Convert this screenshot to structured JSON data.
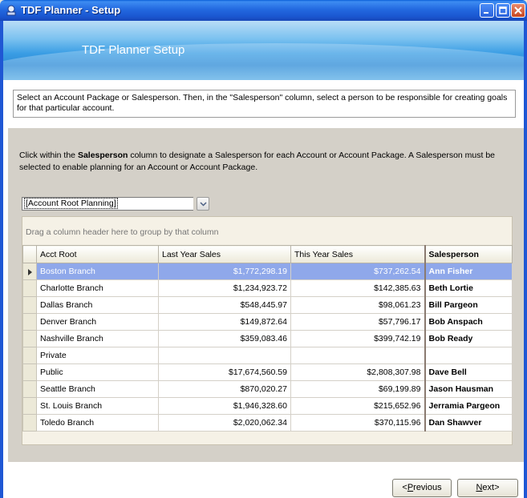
{
  "window": {
    "title": "TDF Planner - Setup",
    "icon": "tdf-planner-icon"
  },
  "banner": {
    "title": "TDF Planner Setup"
  },
  "instructions": "Select an Account Package or Salesperson. Then, in the \"Salesperson\" column, select a person to be responsible for creating goals for that particular account.",
  "panel": {
    "desc_prefix": "Click within the ",
    "desc_bold": "Salesperson",
    "desc_suffix": " column to designate a Salesperson for each Account or Account Package.  A Salesperson must be selected to enable planning for an Account or Account Package.",
    "combo_value": "[Account Root Planning]",
    "group_hint": "Drag a column header here to group by that column"
  },
  "grid": {
    "columns": [
      "Acct Root",
      "Last Year Sales",
      "This Year Sales",
      "Salesperson"
    ],
    "selected_row": 0,
    "rows": [
      {
        "acct": "Boston Branch",
        "last": "$1,772,298.19",
        "this": "$737,262.54",
        "sales": "Ann Fisher"
      },
      {
        "acct": "Charlotte Branch",
        "last": "$1,234,923.72",
        "this": "$142,385.63",
        "sales": "Beth Lortie"
      },
      {
        "acct": "Dallas Branch",
        "last": "$548,445.97",
        "this": "$98,061.23",
        "sales": "Bill Pargeon"
      },
      {
        "acct": "Denver Branch",
        "last": "$149,872.64",
        "this": "$57,796.17",
        "sales": "Bob Anspach"
      },
      {
        "acct": "Nashville Branch",
        "last": "$359,083.46",
        "this": "$399,742.19",
        "sales": "Bob Ready"
      },
      {
        "acct": "Private",
        "last": "",
        "this": "",
        "sales": ""
      },
      {
        "acct": "Public",
        "last": "$17,674,560.59",
        "this": "$2,808,307.98",
        "sales": "Dave Bell"
      },
      {
        "acct": "Seattle Branch",
        "last": "$870,020.27",
        "this": "$69,199.89",
        "sales": "Jason Hausman"
      },
      {
        "acct": "St. Louis Branch",
        "last": "$1,946,328.60",
        "this": "$215,652.96",
        "sales": "Jerramia Pargeon"
      },
      {
        "acct": "Toledo Branch",
        "last": "$2,020,062.34",
        "this": "$370,115.96",
        "sales": "Dan Shawver"
      }
    ]
  },
  "buttons": {
    "previous": {
      "mnemonic": "P",
      "rest": "revious",
      "prefix": "<",
      "suffix": ""
    },
    "next": {
      "prefix": "",
      "mnemonic": "N",
      "rest": "ext",
      "suffix": ">"
    }
  },
  "colors": {
    "titlebar": "#2369e0",
    "selection": "#8fa8ea",
    "panel": "#d4d0c8"
  }
}
